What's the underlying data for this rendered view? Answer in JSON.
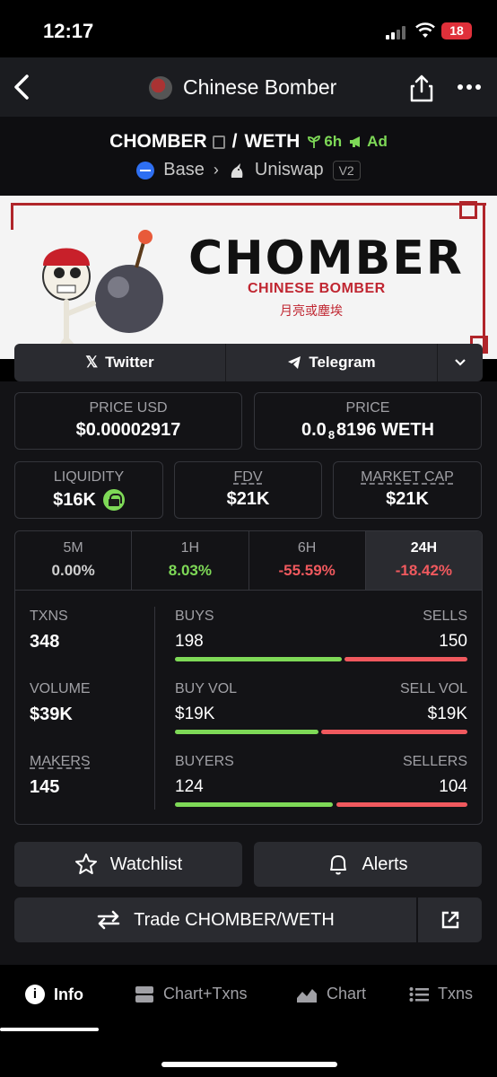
{
  "status_bar": {
    "time": "12:17",
    "battery": "18"
  },
  "header": {
    "title": "Chinese Bomber"
  },
  "pair": {
    "base_token": "CHOMBER",
    "separator": "/",
    "quote_token": "WETH",
    "age": "6h",
    "ad_label": "Ad",
    "chain": "Base",
    "dex": "Uniswap",
    "dex_version": "V2"
  },
  "banner": {
    "title": "CHOMBER",
    "subtitle": "CHINESE BOMBER",
    "chinese": "月亮或塵埃"
  },
  "social": {
    "twitter": "Twitter",
    "telegram": "Telegram"
  },
  "price": {
    "usd_label": "PRICE USD",
    "usd_value": "$0.00002917",
    "native_label": "PRICE",
    "native_prefix": "0.0",
    "native_zeros": "8",
    "native_digits": "8196 WETH"
  },
  "metrics": {
    "liquidity_label": "LIQUIDITY",
    "liquidity_value": "$16K",
    "fdv_label": "FDV",
    "fdv_value": "$21K",
    "mcap_label": "MARKET CAP",
    "mcap_value": "$21K"
  },
  "timeframes": [
    {
      "label": "5M",
      "value": "0.00%"
    },
    {
      "label": "1H",
      "value": "8.03%"
    },
    {
      "label": "6H",
      "value": "-55.59%"
    },
    {
      "label": "24H",
      "value": "-18.42%"
    }
  ],
  "stats": {
    "txns_label": "TXNS",
    "txns_value": "348",
    "volume_label": "VOLUME",
    "volume_value": "$39K",
    "makers_label": "MAKERS",
    "makers_value": "145",
    "buys_label": "BUYS",
    "buys_value": "198",
    "sells_label": "SELLS",
    "sells_value": "150",
    "buy_vol_label": "BUY VOL",
    "buy_vol_value": "$19K",
    "sell_vol_label": "SELL VOL",
    "sell_vol_value": "$19K",
    "buyers_label": "BUYERS",
    "buyers_value": "124",
    "sellers_label": "SELLERS",
    "sellers_value": "104"
  },
  "actions": {
    "watchlist": "Watchlist",
    "alerts": "Alerts",
    "trade": "Trade CHOMBER/WETH"
  },
  "tabbar": {
    "info": "Info",
    "chart_txns": "Chart+Txns",
    "chart": "Chart",
    "txns": "Txns"
  },
  "colors": {
    "green": "#7ed957",
    "red": "#f0595e",
    "chain_blue": "#2e6ff2"
  }
}
